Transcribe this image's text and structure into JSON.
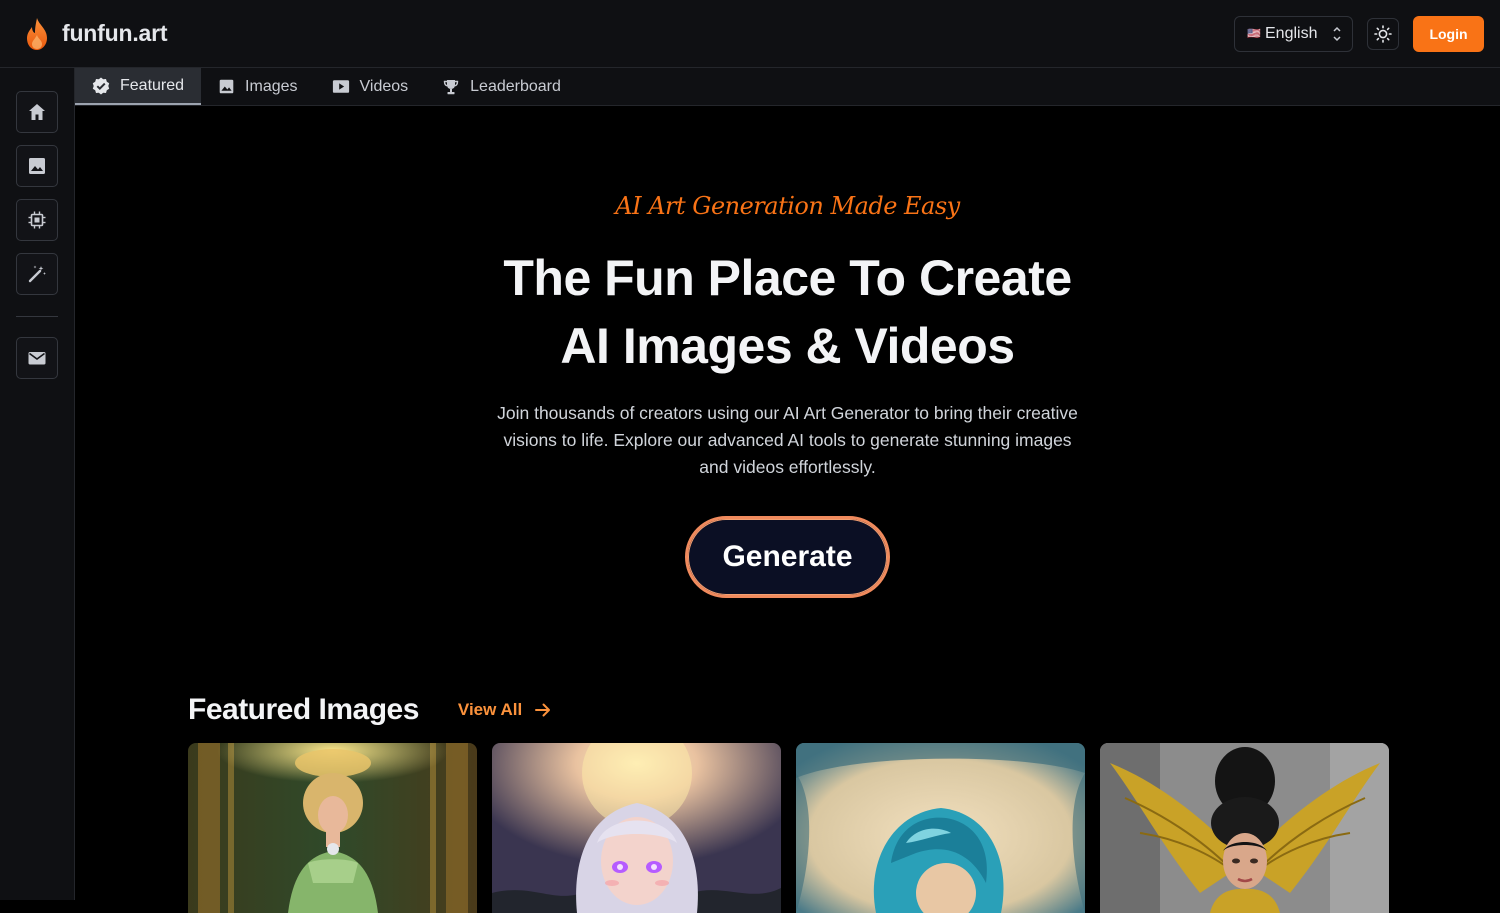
{
  "header": {
    "brand_name": "funfun.art",
    "language": {
      "flag": "🇺🇸",
      "label": "English"
    },
    "login_label": "Login",
    "accent_color": "#f97316"
  },
  "sidebar": {
    "items": [
      {
        "icon": "home-icon"
      },
      {
        "icon": "image-icon"
      },
      {
        "icon": "chip-icon"
      },
      {
        "icon": "magic-wand-icon"
      },
      {
        "icon": "mail-icon"
      }
    ]
  },
  "tabs": [
    {
      "label": "Featured",
      "icon": "verified-badge-icon",
      "active": true
    },
    {
      "label": "Images",
      "icon": "image-icon",
      "active": false
    },
    {
      "label": "Videos",
      "icon": "video-icon",
      "active": false
    },
    {
      "label": "Leaderboard",
      "icon": "trophy-icon",
      "active": false
    }
  ],
  "hero": {
    "tagline": "AI Art Generation Made Easy",
    "title_line1": "The Fun Place To Create",
    "title_line2": "AI Images & Videos",
    "description": "Join thousands of creators using our AI Art Generator to bring their creative visions to life. Explore our advanced AI tools to generate stunning images and videos effortlessly.",
    "cta_label": "Generate"
  },
  "featured": {
    "title": "Featured Images",
    "view_all_label": "View All",
    "cards": [
      {
        "name": "featured-image-1"
      },
      {
        "name": "featured-image-2"
      },
      {
        "name": "featured-image-3"
      },
      {
        "name": "featured-image-4"
      }
    ]
  }
}
